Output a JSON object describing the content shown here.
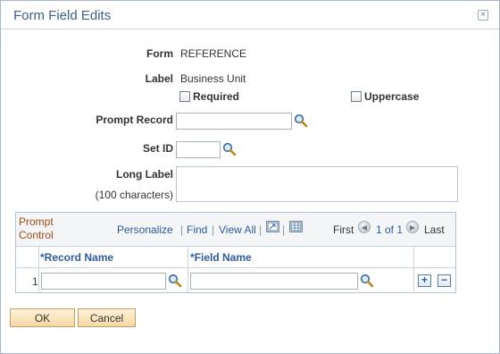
{
  "dialog": {
    "title": "Form Field Edits",
    "close_label": "×"
  },
  "form": {
    "form_label": "Form",
    "form_value": "REFERENCE",
    "label_label": "Label",
    "label_value": "Business Unit",
    "required_label": "Required",
    "uppercase_label": "Uppercase",
    "prompt_record_label": "Prompt Record",
    "prompt_record_value": "",
    "set_id_label": "Set ID",
    "set_id_value": "",
    "long_label_label": "Long Label",
    "long_label_hint": "(100 characters)",
    "long_label_value": ""
  },
  "grid": {
    "title": "Prompt Control",
    "personalize": "Personalize",
    "find": "Find",
    "view_all": "View All",
    "separator": "|",
    "first": "First",
    "range": "1 of 1",
    "last": "Last",
    "columns": [
      "*Record Name",
      "*Field Name"
    ],
    "rows": [
      {
        "num": "1",
        "record_name": "",
        "field_name": ""
      }
    ],
    "add_symbol": "+",
    "delete_symbol": "−"
  },
  "buttons": {
    "ok": "OK",
    "cancel": "Cancel"
  }
}
